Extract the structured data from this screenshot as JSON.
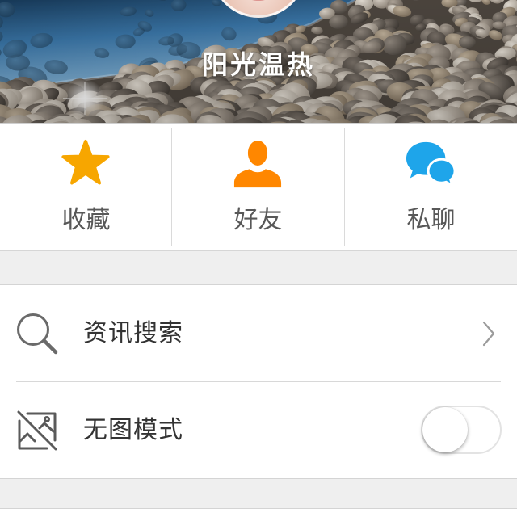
{
  "profile": {
    "username": "阳光温热"
  },
  "actions": [
    {
      "label": "收藏",
      "icon": "star-icon",
      "color": "#f7a600"
    },
    {
      "label": "好友",
      "icon": "person-icon",
      "color": "#ff8700"
    },
    {
      "label": "私聊",
      "icon": "chat-bubbles-icon",
      "color": "#1ea5ea"
    }
  ],
  "settings": [
    {
      "label": "资讯搜索",
      "icon": "search-icon",
      "accessory_icon": "chevron-right-icon"
    },
    {
      "label": "无图模式",
      "icon": "no-image-icon",
      "toggle_on": false
    }
  ]
}
